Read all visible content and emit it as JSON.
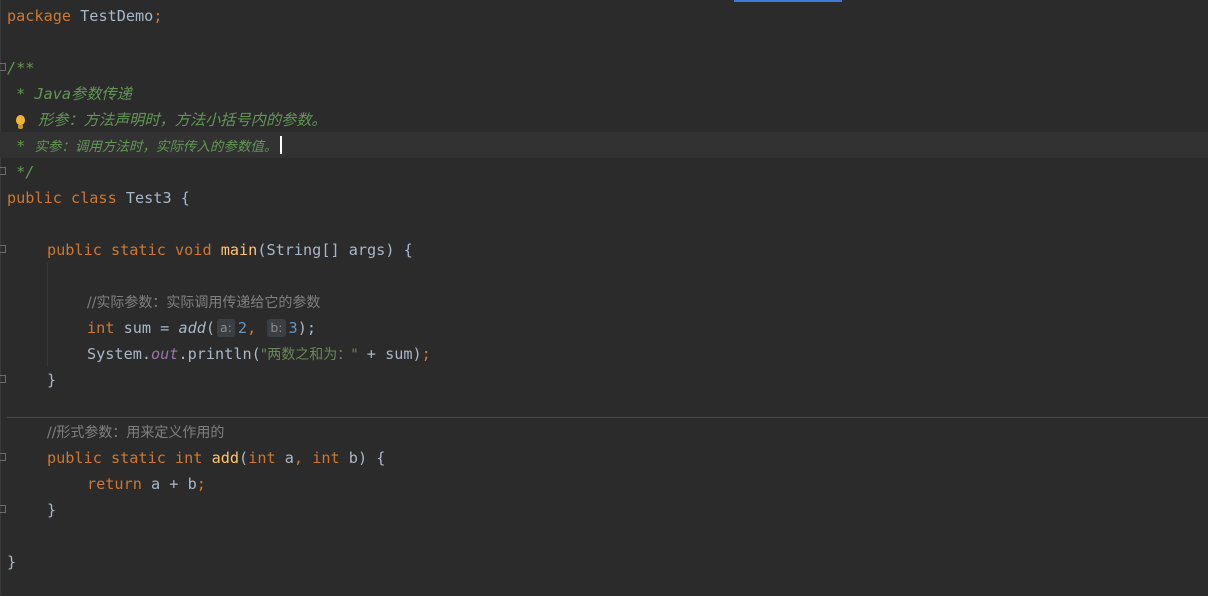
{
  "code": {
    "package_kw": "package",
    "package_name": " TestDemo",
    "semicolon": ";",
    "doc_open": "/**",
    "doc_line1_star": " * ",
    "doc_line1": "Java参数传递",
    "doc_line2": "形参：方法声明时，方法小括号内的参数。",
    "doc_line3_star": " * ",
    "doc_line3": "实参：调用方法时，实际传入的参数值。",
    "doc_close": " */",
    "class_mods": "public class ",
    "class_name": "Test3 {",
    "main_mods": "public static void ",
    "main_name": "main",
    "main_params": "(String[] args) {",
    "comment1": "//实际参数：实际调用传递给它的参数",
    "int_kw": "int",
    "sum_assign": " sum = ",
    "add_call": "add",
    "paren_open": "(",
    "hint_a": "a:",
    "arg_a": "2",
    "comma": ", ",
    "hint_b": "b:",
    "arg_b": "3",
    "call_close": ");",
    "system": "System.",
    "out_field": "out",
    "println": ".println(",
    "str_literal": "\"两数之和为：\"",
    "plus_sum": " + sum)",
    "brace_close": "}",
    "comment2": "//形式参数：用来定义作用的",
    "add_mods": "public static int ",
    "add_name": "add",
    "add_p_open": "(",
    "add_int1": "int",
    "add_a": " a",
    "add_comma": ", ",
    "add_int2": "int",
    "add_b": " b) {",
    "return_kw": "return",
    "return_expr": " a + b",
    "final_brace": "}"
  },
  "colors": {
    "background": "#2b2b2b",
    "keyword": "#cc7832",
    "function": "#ffc66d",
    "number": "#6897bb",
    "string": "#6a8759",
    "doc_comment": "#629755",
    "line_comment": "#808080",
    "field": "#9876aa"
  },
  "icons": {
    "intention": "lightbulb-icon",
    "fold": "fold-marker-icon"
  }
}
